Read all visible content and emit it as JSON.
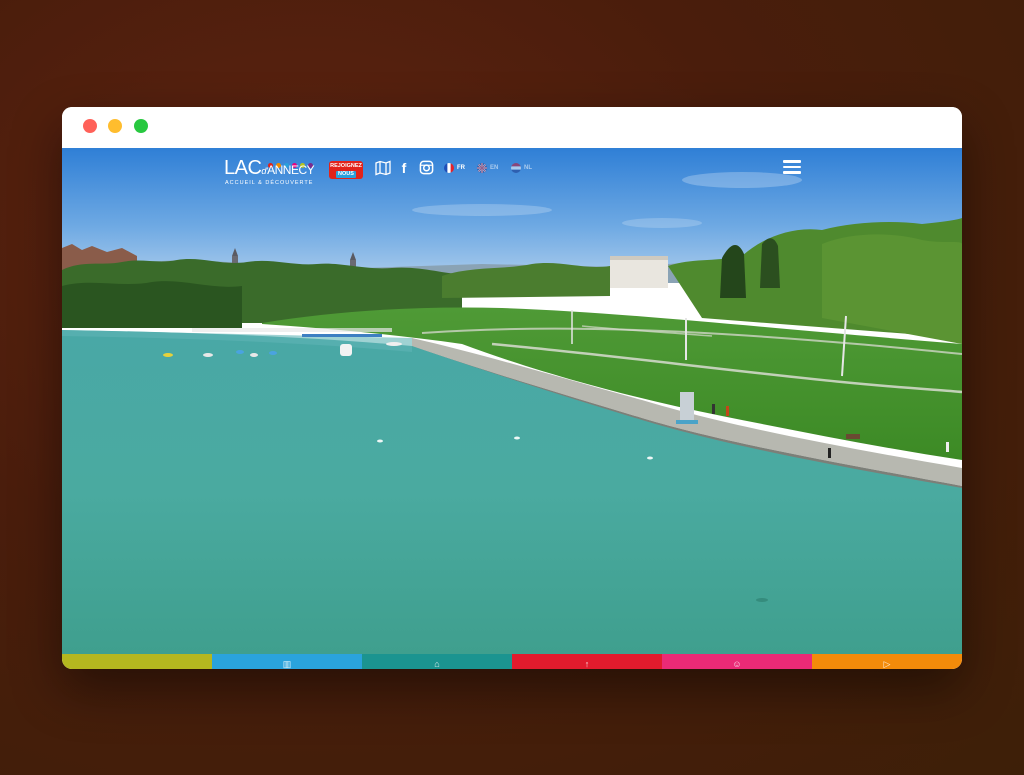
{
  "window": {
    "controls": [
      "close",
      "minimize",
      "maximize"
    ]
  },
  "header": {
    "logo": {
      "main": "LAC",
      "d": "d'",
      "name": "ANNECY",
      "tagline": "ACCUEIL & DÉCOUVERTE",
      "dot_colors": [
        "#e2231a",
        "#f08a00",
        "#2aa0dc",
        "#e6007e",
        "#b5c21d",
        "#7a2b8e"
      ]
    },
    "join_button": {
      "line1": "REJOIGNEZ",
      "line2": "NOUS"
    },
    "icons": [
      "map-icon",
      "facebook-icon",
      "instagram-icon"
    ],
    "languages": [
      {
        "code": "FR",
        "active": true
      },
      {
        "code": "EN",
        "active": false
      },
      {
        "code": "NL",
        "active": false
      }
    ],
    "menu_icon": "hamburger-menu-icon"
  },
  "hero": {
    "description_icon": "lake-photo"
  },
  "category_bar": {
    "segments": [
      {
        "color": "#b5b71f",
        "icon": ""
      },
      {
        "color": "#2aa3dc",
        "icon": "building-icon"
      },
      {
        "color": "#1b9490",
        "icon": "dome-icon"
      },
      {
        "color": "#e21b2d",
        "icon": "arrow-icon"
      },
      {
        "color": "#ea2a76",
        "icon": "people-icon"
      },
      {
        "color": "#f38b0a",
        "icon": "play-icon"
      }
    ]
  }
}
